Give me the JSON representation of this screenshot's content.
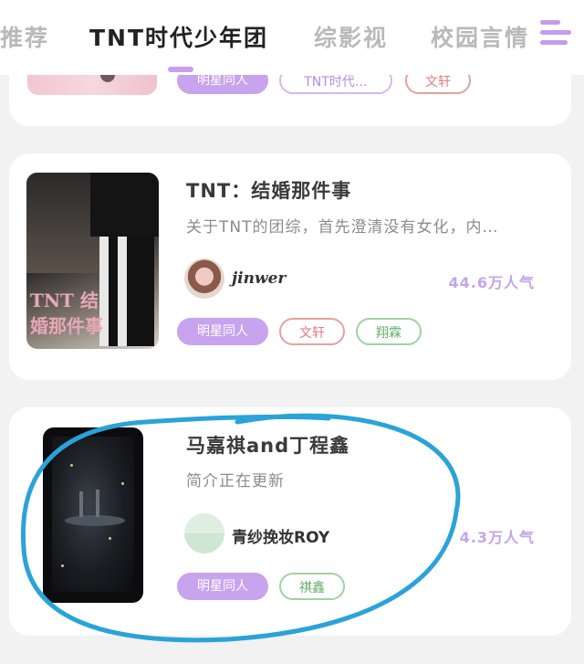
{
  "tabs": [
    {
      "label": "推荐"
    },
    {
      "label": "TNT时代少年团"
    },
    {
      "label": "综影视"
    },
    {
      "label": "校园言情"
    }
  ],
  "active_tab": "TNT时代少年团",
  "colors": {
    "accent": "#c99ef0",
    "popularity": "#c4a4ea",
    "annotation_circle": "#2aa3d8"
  },
  "cards": [
    {
      "title": "",
      "tags": [
        "明星同人",
        "TNT时代…",
        "文轩"
      ]
    },
    {
      "title": "TNT：结婚那件事",
      "description": "关于TNT的团综，首先澄清没有女化，内…",
      "author": "jinwer",
      "popularity": "44.6万人气",
      "tags": [
        "明星同人",
        "文轩",
        "翔霖"
      ],
      "cover_text": "TNT 结婚那件事"
    },
    {
      "title": "马嘉祺and丁程鑫",
      "description": "简介正在更新",
      "author": "青纱挽妆ROY",
      "popularity": "4.3万人气",
      "tags": [
        "明星同人",
        "祺鑫"
      ]
    }
  ]
}
